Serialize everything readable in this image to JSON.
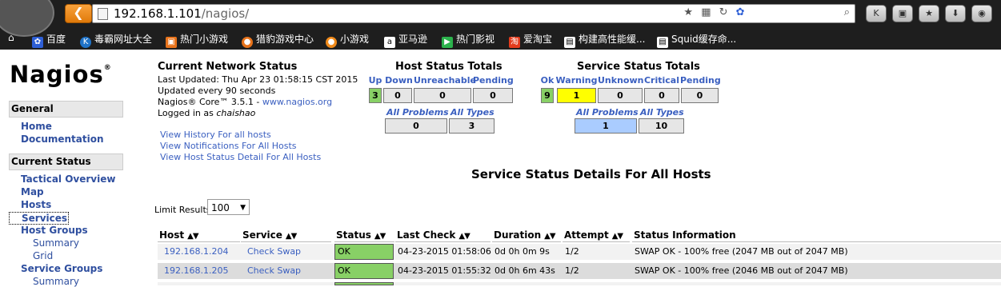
{
  "browser": {
    "url_host": "192.168.1.101",
    "url_path": "/nagios/",
    "bookmarks": [
      {
        "label": "百度",
        "icon": "paw-icon",
        "color": "#2e5fd6"
      },
      {
        "label": "毒霸网址大全",
        "icon": "k-icon",
        "color": "#1f73c9"
      },
      {
        "label": "热门小游戏",
        "icon": "game-icon",
        "color": "#e8731b"
      },
      {
        "label": "猎豹游戏中心",
        "icon": "cheetah-icon",
        "color": "#e8731b"
      },
      {
        "label": "小游戏",
        "icon": "orange-icon",
        "color": "#f08a1a"
      },
      {
        "label": "亚马逊",
        "icon": "amazon-icon",
        "color": "#ffffff"
      },
      {
        "label": "热门影视",
        "icon": "play-icon",
        "color": "#2bb24c"
      },
      {
        "label": "爱淘宝",
        "icon": "taobao-icon",
        "color": "#e43b1c"
      },
      {
        "label": "构建高性能缓...",
        "icon": "page-icon",
        "color": "#ffffff"
      },
      {
        "label": "Squid缓存命...",
        "icon": "page-icon",
        "color": "#ffffff"
      }
    ]
  },
  "sidebar": {
    "logo": "Nagios",
    "logo_mark": "®",
    "general_heading": "General",
    "home": "Home",
    "documentation": "Documentation",
    "current_status_heading": "Current Status",
    "tactical_overview": "Tactical Overview",
    "map": "Map",
    "hosts": "Hosts",
    "services": "Services",
    "host_groups": "Host Groups",
    "host_groups_summary": "Summary",
    "host_groups_grid": "Grid",
    "service_groups": "Service Groups",
    "service_groups_summary": "Summary"
  },
  "network_status": {
    "title": "Current Network Status",
    "last_updated": "Last Updated: Thu Apr 23 01:58:15 CST 2015",
    "update_interval": "Updated every 90 seconds",
    "core_prefix": "Nagios® Core™ 3.5.1 - ",
    "core_link": "www.nagios.org",
    "logged_in_prefix": "Logged in as ",
    "logged_in_user": "chaishao",
    "links": [
      "View History For all hosts",
      "View Notifications For All Hosts",
      "View Host Status Detail For All Hosts"
    ]
  },
  "host_totals": {
    "title": "Host Status Totals",
    "headers": [
      "Up",
      "Down",
      "Unreachable",
      "Pending"
    ],
    "values": [
      "3",
      "0",
      "0",
      "0"
    ],
    "all_problems_label": "All Problems",
    "all_types_label": "All Types",
    "all_problems": "0",
    "all_types": "3"
  },
  "service_totals": {
    "title": "Service Status Totals",
    "headers": [
      "Ok",
      "Warning",
      "Unknown",
      "Critical",
      "Pending"
    ],
    "values": [
      "9",
      "1",
      "0",
      "0",
      "0"
    ],
    "all_problems_label": "All Problems",
    "all_types_label": "All Types",
    "all_problems": "1",
    "all_types": "10"
  },
  "colors": {
    "ok_green": "#88d066",
    "warning_yellow": "#ffff00",
    "problem_blue": "#aaccff",
    "link_blue": "#3a5fc0"
  },
  "details": {
    "title": "Service Status Details For All Hosts",
    "limit_label": "Limit Results:",
    "limit_value": "100",
    "columns": [
      "Host",
      "Service",
      "Status",
      "Last Check",
      "Duration",
      "Attempt",
      "Status Information"
    ],
    "rows": [
      {
        "host": "192.168.1.204",
        "service": "Check Swap",
        "status": "OK",
        "last_check": "04-23-2015 01:58:06",
        "duration": "0d 0h 0m 9s",
        "attempt": "1/2",
        "info": "SWAP OK - 100% free (2047 MB out of 2047 MB)"
      },
      {
        "host": "192.168.1.205",
        "service": "Check Swap",
        "status": "OK",
        "last_check": "04-23-2015 01:55:32",
        "duration": "0d 0h 6m 43s",
        "attempt": "1/2",
        "info": "SWAP OK - 100% free (2046 MB out of 2047 MB)"
      }
    ]
  }
}
